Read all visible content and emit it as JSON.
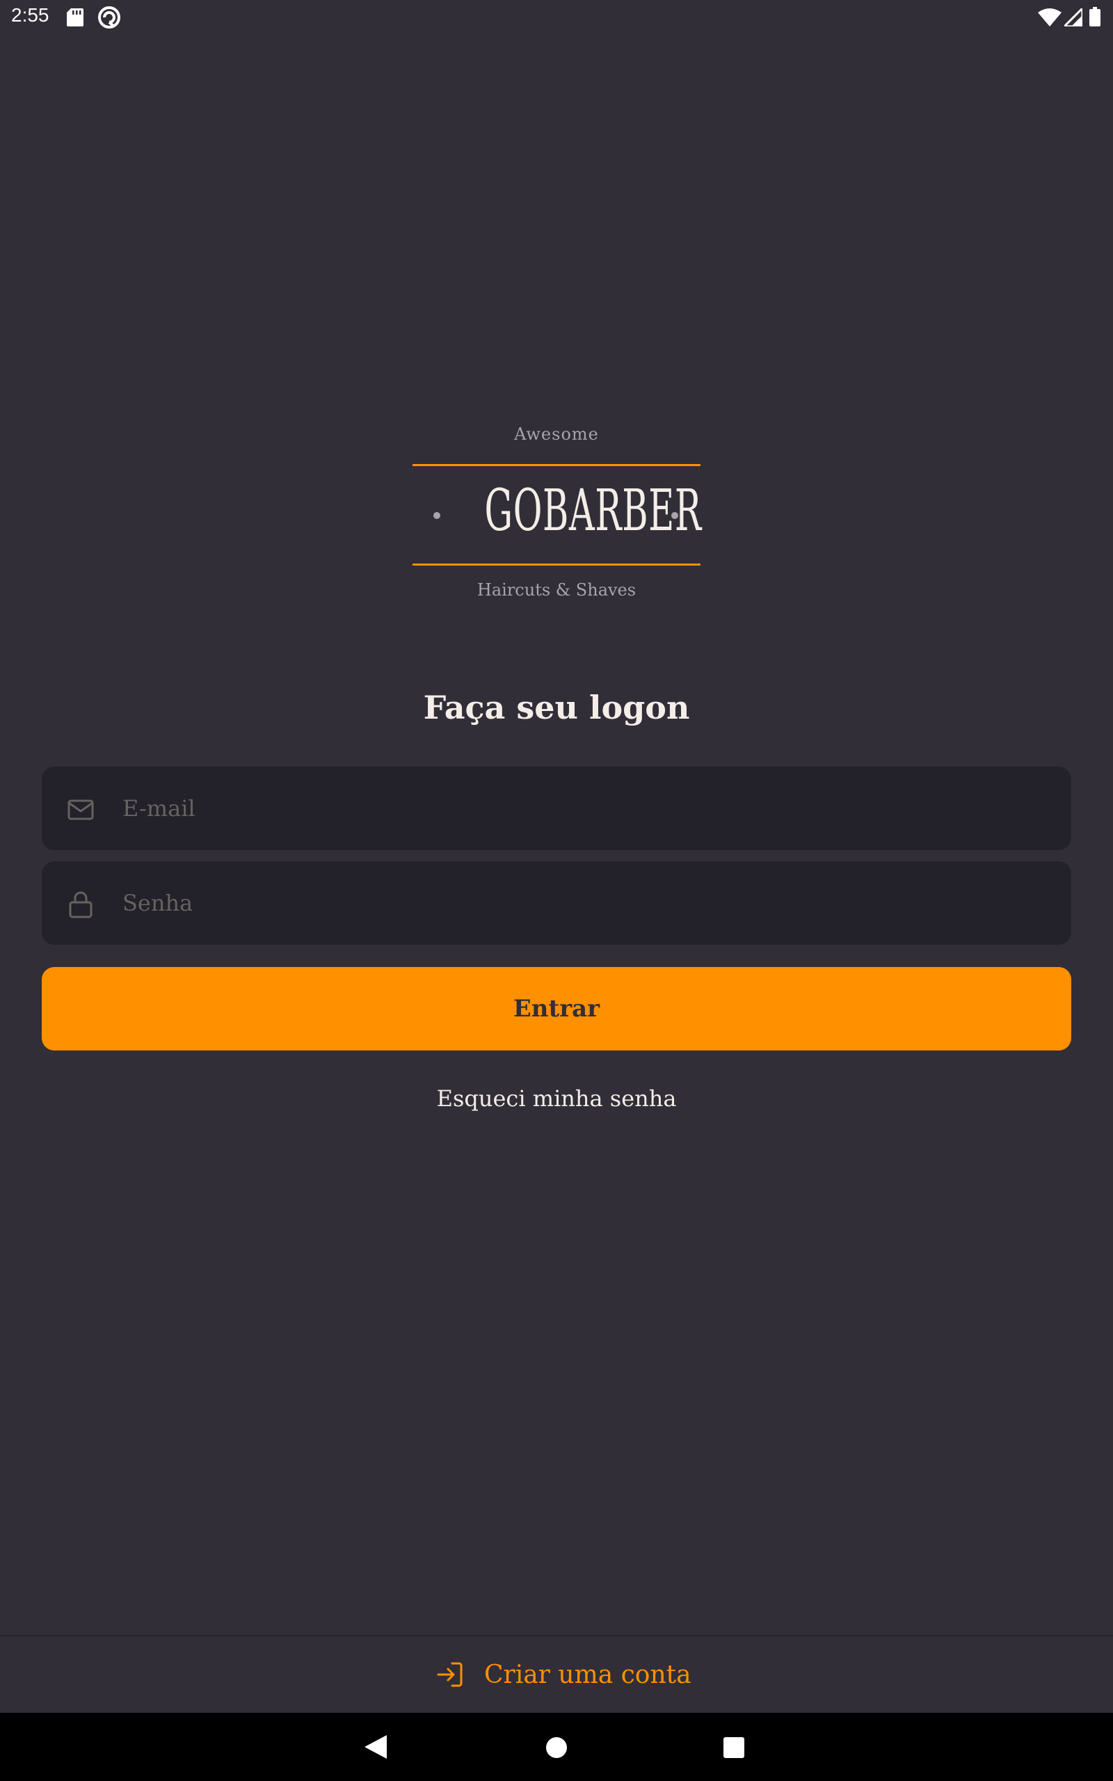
{
  "status_bar": {
    "time": "2:55"
  },
  "logo": {
    "top_text": "Awesome",
    "name": "GOBARBER",
    "tagline": "Haircuts & Shaves"
  },
  "login": {
    "title": "Faça seu logon",
    "email_placeholder": "E-mail",
    "password_placeholder": "Senha",
    "submit_label": "Entrar",
    "forgot_label": "Esqueci minha senha"
  },
  "footer": {
    "create_account_label": "Criar uma conta"
  },
  "icons": {
    "email": "mail-icon",
    "password": "lock-icon",
    "create_account": "log-in-icon"
  },
  "colors": {
    "background": "#312e38",
    "input_background": "#232129",
    "accent": "#ff9000",
    "text": "#f4ede8",
    "placeholder": "#666360",
    "muted": "#a8a3ad"
  }
}
